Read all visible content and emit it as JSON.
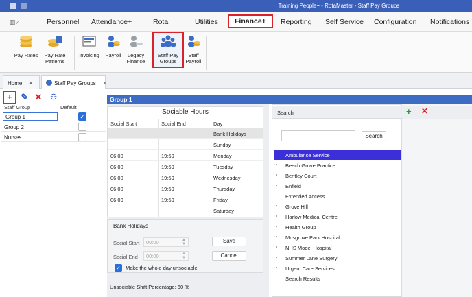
{
  "window": {
    "title": "Training People+ - RotaMaster - Staff Pay Groups"
  },
  "menu": {
    "toggle_icon": "sidebar-toggle-icon",
    "items": [
      {
        "label": "Personnel"
      },
      {
        "label": "Attendance+"
      },
      {
        "label": "Rota"
      },
      {
        "label": "Utilities"
      },
      {
        "label": "Finance+",
        "active": true
      },
      {
        "label": "Reporting"
      },
      {
        "label": "Self Service"
      },
      {
        "label": "Configuration"
      },
      {
        "label": "Notifications"
      }
    ]
  },
  "ribbon": {
    "buttons": [
      {
        "label": "Pay Rates",
        "icon": "coins-icon"
      },
      {
        "label": "Pay Rate Patterns",
        "icon": "coins-calendar-icon"
      },
      {
        "label": "Invoicing",
        "icon": "invoice-icon"
      },
      {
        "label": "Payroll",
        "icon": "payroll-icon"
      },
      {
        "label": "Legacy Finance",
        "icon": "legacy-finance-icon"
      },
      {
        "label": "Staff Pay Groups",
        "icon": "staff-group-icon",
        "highlighted": true
      },
      {
        "label": "Staff Payroll",
        "icon": "staff-payroll-icon"
      }
    ]
  },
  "tabs": [
    {
      "label": "Home",
      "close": "×"
    },
    {
      "label": "Staff Pay Groups",
      "close": "×",
      "selected": true
    }
  ],
  "left": {
    "columns": [
      "Staff Group",
      "Default"
    ],
    "rows": [
      {
        "name": "Group 1",
        "default": true,
        "selected": true
      },
      {
        "name": "Group 2",
        "default": false
      },
      {
        "name": "Nurses",
        "default": false
      }
    ]
  },
  "group_header": "Group 1",
  "sociable": {
    "title": "Sociable Hours",
    "columns": [
      "Social Start",
      "Social End",
      "Day"
    ],
    "rows": [
      {
        "start": "",
        "end": "",
        "day": "Bank Holidays",
        "shaded": true
      },
      {
        "start": "",
        "end": "",
        "day": "Sunday"
      },
      {
        "start": "06:00",
        "end": "19:59",
        "day": "Monday"
      },
      {
        "start": "06:00",
        "end": "19:59",
        "day": "Tuesday"
      },
      {
        "start": "06:00",
        "end": "19:59",
        "day": "Wednesday"
      },
      {
        "start": "06:00",
        "end": "19:59",
        "day": "Thursday"
      },
      {
        "start": "06:00",
        "end": "19:59",
        "day": "Friday"
      },
      {
        "start": "",
        "end": "",
        "day": "Saturday"
      }
    ]
  },
  "bank": {
    "title": "Bank Holidays",
    "start_label": "Social Start",
    "end_label": "Social End",
    "start_value": "00:00",
    "end_value": "00:00",
    "save": "Save",
    "cancel": "Cancel",
    "whole_day_label": "Make the whole day unsociable",
    "whole_day_checked": true
  },
  "unsociable": "Unsociable Shift Percentage:  60 %",
  "right": {
    "header": "Search",
    "search_button": "Search",
    "items": [
      {
        "label": "Ambulance Service",
        "arrow": "",
        "selected": true
      },
      {
        "label": "Beech Grove Practice",
        "arrow": "›"
      },
      {
        "label": "Bentley Court",
        "arrow": "›"
      },
      {
        "label": "Enfield",
        "arrow": "›"
      },
      {
        "label": "Extended Access",
        "arrow": ""
      },
      {
        "label": "Grove Hill",
        "arrow": "›"
      },
      {
        "label": "Harlow Medical Centre",
        "arrow": "›"
      },
      {
        "label": "Health Group",
        "arrow": "›"
      },
      {
        "label": "Musgrove Park Hospital",
        "arrow": "›"
      },
      {
        "label": "NHS Model Hospital",
        "arrow": "›"
      },
      {
        "label": "Summer Lane Surgery",
        "arrow": "›"
      },
      {
        "label": "Urgent Care Services",
        "arrow": "›"
      },
      {
        "label": "Search Results",
        "arrow": ""
      }
    ]
  },
  "colors": {
    "accent": "#3c6cc4",
    "highlight_border": "#d6242a",
    "selected_tree": "#3a2fd8"
  }
}
